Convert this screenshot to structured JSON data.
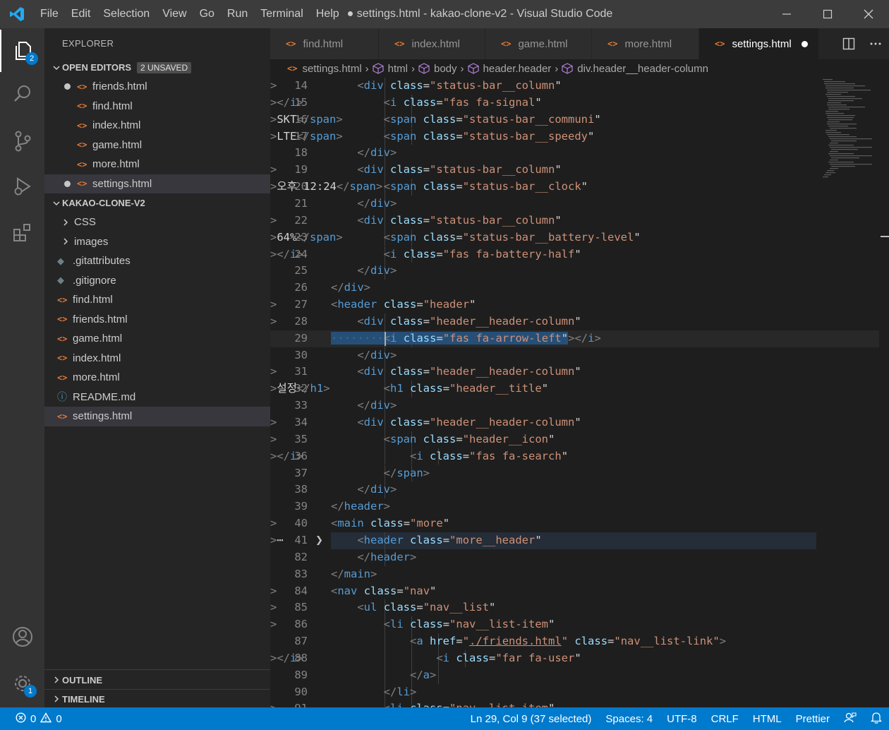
{
  "titlebar": {
    "menu": [
      "File",
      "Edit",
      "Selection",
      "View",
      "Go",
      "Run",
      "Terminal",
      "Help"
    ],
    "title": "● settings.html - kakao-clone-v2 - Visual Studio Code"
  },
  "activity": {
    "explorer_badge": "2",
    "settings_badge": "1"
  },
  "sidebar": {
    "header": "EXPLORER",
    "open_editors_label": "OPEN EDITORS",
    "unsaved_badge": "2 UNSAVED",
    "open_editors": [
      {
        "name": "friends.html",
        "modified": true
      },
      {
        "name": "find.html",
        "modified": false
      },
      {
        "name": "index.html",
        "modified": false
      },
      {
        "name": "game.html",
        "modified": false
      },
      {
        "name": "more.html",
        "modified": false
      },
      {
        "name": "settings.html",
        "modified": true
      }
    ],
    "project_label": "KAKAO-CLONE-V2",
    "folders": [
      "CSS",
      "images"
    ],
    "files": [
      ".gitattributes",
      ".gitignore",
      "find.html",
      "friends.html",
      "game.html",
      "index.html",
      "more.html",
      "README.md",
      "settings.html"
    ],
    "outline_label": "OUTLINE",
    "timeline_label": "TIMELINE"
  },
  "tabs": [
    "find.html",
    "index.html",
    "game.html",
    "more.html",
    "settings.html"
  ],
  "breadcrumb": [
    "settings.html",
    "html",
    "body",
    "header.header",
    "div.header__header-column"
  ],
  "editor": {
    "line_numbers": [
      "14",
      "15",
      "16",
      "17",
      "18",
      "19",
      "20",
      "21",
      "22",
      "23",
      "24",
      "25",
      "26",
      "27",
      "28",
      "29",
      "30",
      "31",
      "32",
      "33",
      "34",
      "35",
      "36",
      "37",
      "38",
      "39",
      "40",
      "41",
      "82",
      "83",
      "84",
      "85",
      "86",
      "87",
      "88",
      "89",
      "90",
      "91"
    ]
  },
  "statusbar": {
    "errors": "0",
    "warnings": "0",
    "position": "Ln 29, Col 9 (37 selected)",
    "spaces": "Spaces: 4",
    "encoding": "UTF-8",
    "eol": "CRLF",
    "language": "HTML",
    "formatter": "Prettier"
  }
}
